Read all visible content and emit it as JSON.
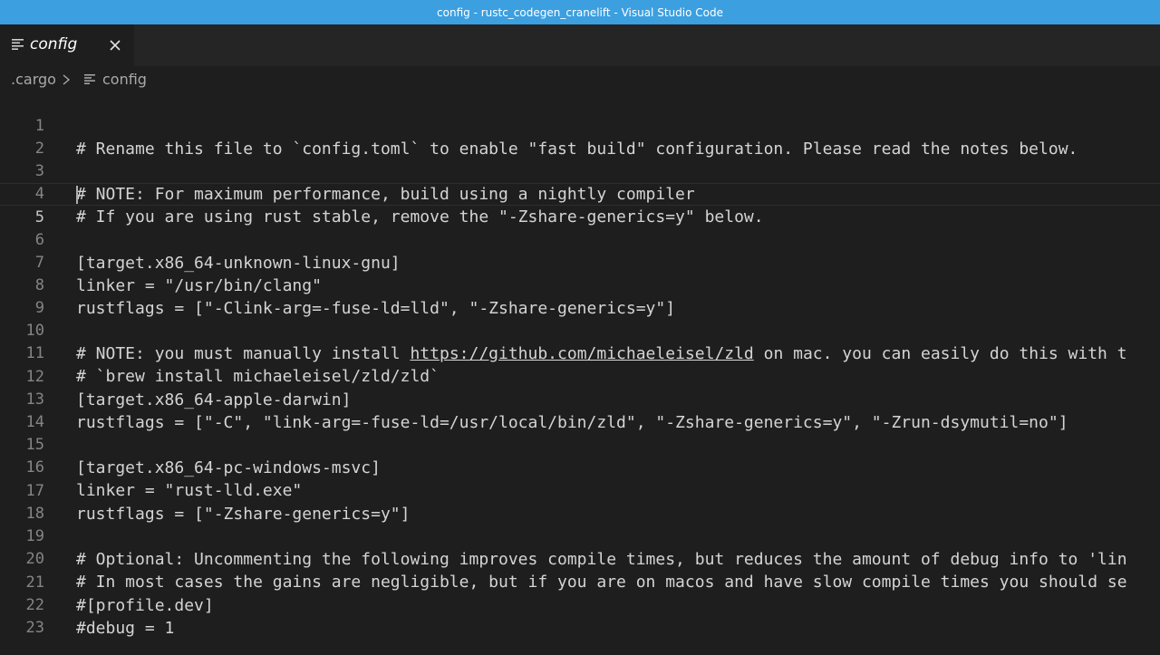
{
  "window": {
    "title": "config - rustc_codegen_cranelift - Visual Studio Code"
  },
  "tab": {
    "label": "config",
    "icon": "file-lines-icon",
    "close_icon": "close-icon"
  },
  "breadcrumb": {
    "folder": ".cargo",
    "separator_icon": "chevron-right-icon",
    "file_icon": "file-lines-icon",
    "file": "config"
  },
  "editor": {
    "cursor_line": 5,
    "lines": [
      {
        "num": "1",
        "text": "# Rename this file to `config.toml` to enable \"fast build\" configuration. Please read the notes below."
      },
      {
        "num": "2",
        "text": ""
      },
      {
        "num": "3",
        "text": "# NOTE: For maximum performance, build using a nightly compiler"
      },
      {
        "num": "4",
        "text": "# If you are using rust stable, remove the \"-Zshare-generics=y\" below."
      },
      {
        "num": "5",
        "text": ""
      },
      {
        "num": "6",
        "text": "[target.x86_64-unknown-linux-gnu]"
      },
      {
        "num": "7",
        "text": "linker = \"/usr/bin/clang\""
      },
      {
        "num": "8",
        "text": "rustflags = [\"-Clink-arg=-fuse-ld=lld\", \"-Zshare-generics=y\"]"
      },
      {
        "num": "9",
        "text": ""
      },
      {
        "num": "10",
        "pre": "# NOTE: you must manually install ",
        "link": "https://github.com/michaeleisel/zld",
        "post": " on mac. you can easily do this with t"
      },
      {
        "num": "11",
        "text": "# `brew install michaeleisel/zld/zld`"
      },
      {
        "num": "12",
        "text": "[target.x86_64-apple-darwin]"
      },
      {
        "num": "13",
        "text": "rustflags = [\"-C\", \"link-arg=-fuse-ld=/usr/local/bin/zld\", \"-Zshare-generics=y\", \"-Zrun-dsymutil=no\"]"
      },
      {
        "num": "14",
        "text": ""
      },
      {
        "num": "15",
        "text": "[target.x86_64-pc-windows-msvc]"
      },
      {
        "num": "16",
        "text": "linker = \"rust-lld.exe\""
      },
      {
        "num": "17",
        "text": "rustflags = [\"-Zshare-generics=y\"]"
      },
      {
        "num": "18",
        "text": ""
      },
      {
        "num": "19",
        "text": "# Optional: Uncommenting the following improves compile times, but reduces the amount of debug info to 'lin"
      },
      {
        "num": "20",
        "text": "# In most cases the gains are negligible, but if you are on macos and have slow compile times you should se"
      },
      {
        "num": "21",
        "text": "#[profile.dev]"
      },
      {
        "num": "22",
        "text": "#debug = 1"
      },
      {
        "num": "23",
        "text": ""
      }
    ]
  },
  "colors": {
    "titlebar": "#3c9fe0",
    "editor_bg": "#1e1e1e",
    "tabbar_bg": "#252526",
    "text": "#d4d4d4",
    "line_number": "#858585"
  }
}
